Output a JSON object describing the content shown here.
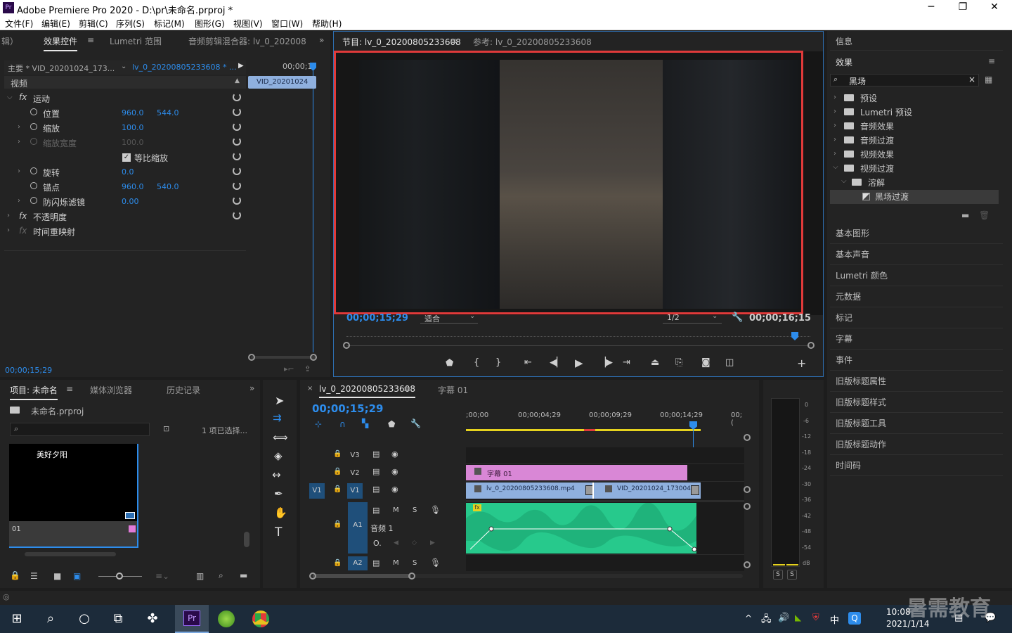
{
  "window": {
    "title": "Adobe Premiere Pro 2020 - D:\\pr\\未命名.prproj *",
    "app_icon": "Pr",
    "minimize": "─",
    "maximize": "❐",
    "close": "✕"
  },
  "menu": [
    "文件(F)",
    "编辑(E)",
    "剪辑(C)",
    "序列(S)",
    "标记(M)",
    "图形(G)",
    "视图(V)",
    "窗口(W)",
    "帮助(H)"
  ],
  "effect_controls": {
    "tabs": [
      "辑）",
      "效果控件",
      "Lumetri 范围",
      "音频剪辑混合器: lv_0_202008"
    ],
    "master": "主要 * VID_20201024_173...",
    "sequence": "lv_0_20200805233608 * ...",
    "timecode_ruler": "00;00;1",
    "clip": "VID_20201024",
    "section": "视频",
    "motion": "运动",
    "props": [
      {
        "label": "位置",
        "v1": "960.0",
        "v2": "544.0"
      },
      {
        "label": "缩放",
        "v1": "100.0"
      },
      {
        "label": "缩放宽度",
        "v1": "100.0"
      },
      {
        "label": "等比缩放"
      },
      {
        "label": "旋转",
        "v1": "0.0"
      },
      {
        "label": "锚点",
        "v1": "960.0",
        "v2": "540.0"
      },
      {
        "label": "防闪烁滤镜",
        "v1": "0.00"
      }
    ],
    "opacity": "不透明度",
    "time_remap": "时间重映射",
    "fx": "fx",
    "bottom_timecode": "00;00;15;29"
  },
  "program_monitor": {
    "tab_program": "节目: lv_0_20200805233608",
    "tab_reference": "参考: lv_0_20200805233608",
    "timecode": "00;00;15;29",
    "fit": "适合",
    "resolution": "1/2",
    "duration": "00;00;16;15"
  },
  "project": {
    "tabs": [
      "项目: 未命名",
      "媒体浏览器",
      "历史记录"
    ],
    "file": "未命名.prproj",
    "selected": "1 项已选择...",
    "thumb_text": "美好夕阳",
    "thumb_label": "01"
  },
  "timeline": {
    "tab": "lv_0_20200805233608",
    "tab2": "字幕 01",
    "timecode": "00;00;15;29",
    "ruler": [
      ";00;00",
      "00;00;04;29",
      "00;00;09;29",
      "00;00;14;29",
      "00;("
    ],
    "tracks": [
      "V3",
      "V2",
      "V1",
      "A1",
      "A2"
    ],
    "clip_title": "字幕 01",
    "clip_v1a": "lv_0_20200805233608.mp4",
    "clip_v1b": "VID_20201024_173004.",
    "audio_label": "音频 1",
    "m": "M",
    "s": "S",
    "fx": "fx"
  },
  "meter": {
    "scale": [
      "0",
      "-6",
      "-12",
      "-18",
      "-24",
      "-30",
      "-36",
      "-42",
      "-48",
      "-54",
      "dB"
    ],
    "s1": "S",
    "s2": "S"
  },
  "effects_panel": {
    "info": "信息",
    "title": "效果",
    "search": "黑场",
    "tree": [
      {
        "label": "预设",
        "level": 0
      },
      {
        "label": "Lumetri 预设",
        "level": 0
      },
      {
        "label": "音频效果",
        "level": 0
      },
      {
        "label": "音频过渡",
        "level": 0
      },
      {
        "label": "视频效果",
        "level": 0
      },
      {
        "label": "视频过渡",
        "level": 0
      },
      {
        "label": "溶解",
        "level": 1
      },
      {
        "label": "黑场过渡",
        "level": 2
      }
    ],
    "panels": [
      "基本图形",
      "基本声音",
      "Lumetri 颜色",
      "元数据",
      "标记",
      "字幕",
      "事件",
      "旧版标题属性",
      "旧版标题样式",
      "旧版标题工具",
      "旧版标题动作",
      "时间码"
    ]
  },
  "taskbar": {
    "time": "10:08",
    "date": "2021/1/14",
    "lang": "中",
    "watermark": "暑需教育"
  }
}
